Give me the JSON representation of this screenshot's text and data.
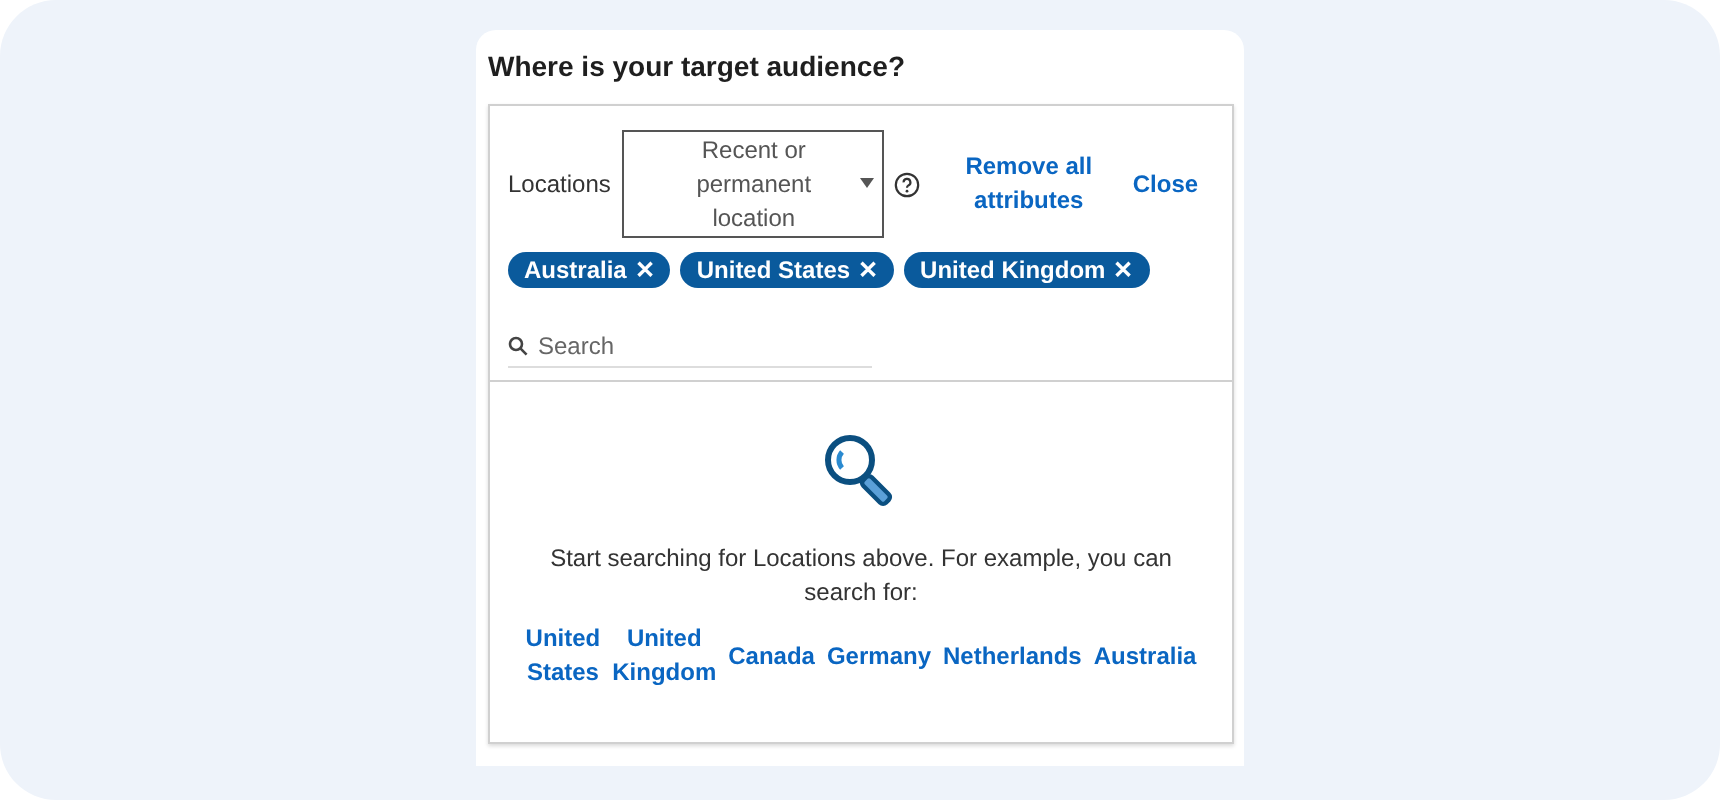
{
  "title": "Where is your target audience?",
  "filter": {
    "label": "Locations",
    "dropdown": "Recent or permanent location",
    "remove_all": "Remove all attributes",
    "close": "Close"
  },
  "tags": [
    {
      "label": "Australia",
      "remove": "✕"
    },
    {
      "label": "United States",
      "remove": "✕"
    },
    {
      "label": "United Kingdom",
      "remove": "✕"
    }
  ],
  "search": {
    "placeholder": "Search"
  },
  "empty_state": {
    "message": "Start searching for Locations above. For example, you can search for:",
    "suggestions": [
      "United States",
      "United Kingdom",
      "Canada",
      "Germany",
      "Netherlands",
      "Australia"
    ]
  }
}
